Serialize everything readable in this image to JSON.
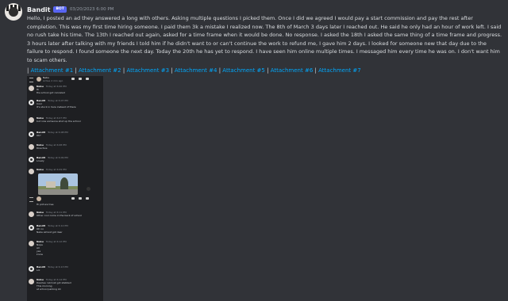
{
  "message": {
    "author": "Bandit",
    "badge": "BOT",
    "timestamp": "03/20/2023 6:00 PM",
    "lines": [
      "Hello, I posted an ad they answered a long with others. Asking multiple questions I picked them. Once I did we agreed I would pay a start commission and pay the rest after",
      "completion. This was my first time hiring someone. I paid them 3k a mistake I realized now. The 8th of March 3 days later I reached out. He said he only had an hour of work left. I said",
      "no rush take his time. The 13th I reached out again, asked for a time frame when it would be done. No response. I asked the 18th I asked the same thing of a time frame and progress.",
      "3 hours later after talking with my friends I told him if he didn't want to or can't continue the work to refund me, I gave him 2 days. I looked for someone new that day due to the",
      "failure to respond. I found someone the next day. Today the 20th he has yet to respond. I have seen him online multiple times. I messaged him every time he was on. I don't want him",
      "to scam others."
    ],
    "attachments": [
      "Attachment #1",
      "Attachment #2",
      "Attachment #3",
      "Attachment #4",
      "Attachment #5",
      "Attachment #6",
      "Attachment #7"
    ]
  },
  "chat": {
    "contact": "Nebu",
    "contact_sub": "Active 2 min ago",
    "rows": [
      {
        "name": "Nebu",
        "time": "Today at 6:06 PM",
        "lines": [
          "Hi",
          "the school got canceled"
        ]
      },
      {
        "name": "Bandit",
        "time": "Today at 6:07 PM",
        "lines": [
          "Cool",
          "It's stuck in here instead of there"
        ]
      },
      {
        "name": "Nebu",
        "time": "Today at 6:07 PM",
        "lines": [
          "but now someone shut up the school"
        ]
      },
      {
        "name": "Bandit",
        "time": "Today at 6:08 PM",
        "lines": [
          "Ok?"
        ]
      },
      {
        "name": "Nebu",
        "time": "Today at 6:08 PM",
        "lines": [
          "Directive"
        ]
      },
      {
        "name": "Bandit",
        "time": "Today at 6:09 PM",
        "lines": [
          "Lovely"
        ]
      },
      {
        "name": "Nebu",
        "time": "Today at 6:09 PM",
        "lines": []
      },
      {
        "name": "Nebu",
        "time": "Today at 6:10 PM",
        "lines": [
          "Hi picture tree"
        ]
      },
      {
        "name": "Nebu",
        "time": "Today at 6:11 PM",
        "lines": [
          "Other cool come in the back of school"
        ]
      },
      {
        "name": "Bandit",
        "time": "Today at 6:12 PM",
        "lines": [
          "Oh no",
          "Nebe almost got dear"
        ]
      },
      {
        "name": "Nebu",
        "time": "Today at 6:12 PM",
        "lines": [
          "Nope",
          "All",
          "yes",
          "know"
        ]
      },
      {
        "name": "Bandit",
        "time": "Today at 6:13 PM",
        "lines": [
          "Lol"
        ]
      },
      {
        "name": "Nebu",
        "time": "Today at 6:14 PM",
        "lines": [
          "Dearlee I almost got stabbed",
          "This morning",
          "at school parking lot"
        ]
      }
    ]
  }
}
